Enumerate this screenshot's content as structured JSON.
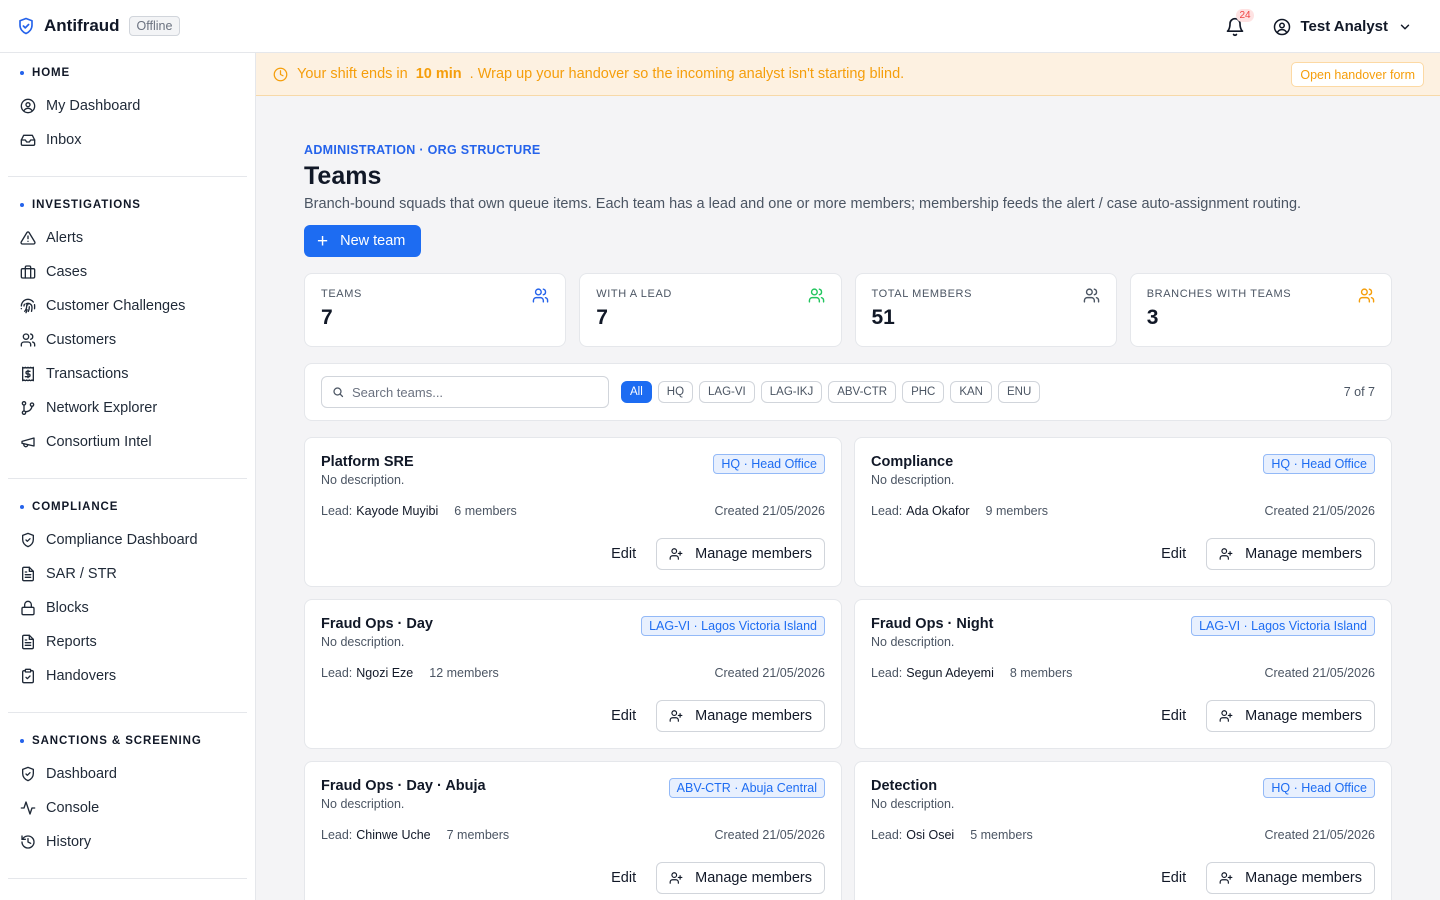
{
  "app": {
    "name": "Antifraud",
    "status_badge": "Offline"
  },
  "header": {
    "notifications_count": "24",
    "user_name": "Test Analyst"
  },
  "sidebar": {
    "sections": [
      {
        "title": "HOME",
        "items": [
          {
            "label": "My Dashboard",
            "icon": "user-circle-icon"
          },
          {
            "label": "Inbox",
            "icon": "inbox-icon"
          }
        ]
      },
      {
        "title": "INVESTIGATIONS",
        "items": [
          {
            "label": "Alerts",
            "icon": "alert-triangle-icon"
          },
          {
            "label": "Cases",
            "icon": "briefcase-icon"
          },
          {
            "label": "Customer Challenges",
            "icon": "fingerprint-icon"
          },
          {
            "label": "Customers",
            "icon": "users-icon"
          },
          {
            "label": "Transactions",
            "icon": "receipt-icon"
          },
          {
            "label": "Network Explorer",
            "icon": "git-branch-icon"
          },
          {
            "label": "Consortium Intel",
            "icon": "megaphone-icon"
          }
        ]
      },
      {
        "title": "COMPLIANCE",
        "items": [
          {
            "label": "Compliance Dashboard",
            "icon": "shield-check-icon"
          },
          {
            "label": "SAR / STR",
            "icon": "file-text-icon"
          },
          {
            "label": "Blocks",
            "icon": "lock-icon"
          },
          {
            "label": "Reports",
            "icon": "file-text-icon"
          },
          {
            "label": "Handovers",
            "icon": "clipboard-check-icon"
          }
        ]
      },
      {
        "title": "SANCTIONS & SCREENING",
        "items": [
          {
            "label": "Dashboard",
            "icon": "shield-check-icon"
          },
          {
            "label": "Console",
            "icon": "activity-icon"
          },
          {
            "label": "History",
            "icon": "history-icon"
          }
        ]
      }
    ]
  },
  "banner": {
    "prefix": "Your shift ends in",
    "time": "10 min",
    "suffix": ". Wrap up your handover so the incoming analyst isn't starting blind.",
    "button": "Open handover form"
  },
  "page": {
    "breadcrumb": "ADMINISTRATION · ORG STRUCTURE",
    "title": "Teams",
    "description": "Branch-bound squads that own queue items. Each team has a lead and one or more members; membership feeds the alert / case auto-assignment routing.",
    "new_button": "New team"
  },
  "stats": [
    {
      "label": "TEAMS",
      "value": "7",
      "icon_color": "#2563eb"
    },
    {
      "label": "WITH A LEAD",
      "value": "7",
      "icon_color": "#22c55e"
    },
    {
      "label": "TOTAL MEMBERS",
      "value": "51",
      "icon_color": "#4b5563"
    },
    {
      "label": "BRANCHES WITH TEAMS",
      "value": "3",
      "icon_color": "#f59e0b"
    }
  ],
  "filter": {
    "search_placeholder": "Search teams...",
    "chips": [
      "All",
      "HQ",
      "LAG-VI",
      "LAG-IKJ",
      "ABV-CTR",
      "PHC",
      "KAN",
      "ENU"
    ],
    "active_chip": "All",
    "count": "7 of 7"
  },
  "card_labels": {
    "lead": "Lead:",
    "edit": "Edit",
    "manage": "Manage members"
  },
  "teams": [
    {
      "name": "Platform SRE",
      "description": "No description.",
      "branch": "HQ · Head Office",
      "lead": "Kayode Muyibi",
      "members": "6 members",
      "created": "Created 21/05/2026"
    },
    {
      "name": "Compliance",
      "description": "No description.",
      "branch": "HQ · Head Office",
      "lead": "Ada Okafor",
      "members": "9 members",
      "created": "Created 21/05/2026"
    },
    {
      "name": "Fraud Ops · Day",
      "description": "No description.",
      "branch": "LAG-VI · Lagos Victoria Island",
      "lead": "Ngozi Eze",
      "members": "12 members",
      "created": "Created 21/05/2026"
    },
    {
      "name": "Fraud Ops · Night",
      "description": "No description.",
      "branch": "LAG-VI · Lagos Victoria Island",
      "lead": "Segun Adeyemi",
      "members": "8 members",
      "created": "Created 21/05/2026"
    },
    {
      "name": "Fraud Ops · Day · Abuja",
      "description": "No description.",
      "branch": "ABV-CTR · Abuja Central",
      "lead": "Chinwe Uche",
      "members": "7 members",
      "created": "Created 21/05/2026"
    },
    {
      "name": "Detection",
      "description": "No description.",
      "branch": "HQ · Head Office",
      "lead": "Osi Osei",
      "members": "5 members",
      "created": "Created 21/05/2026"
    }
  ]
}
